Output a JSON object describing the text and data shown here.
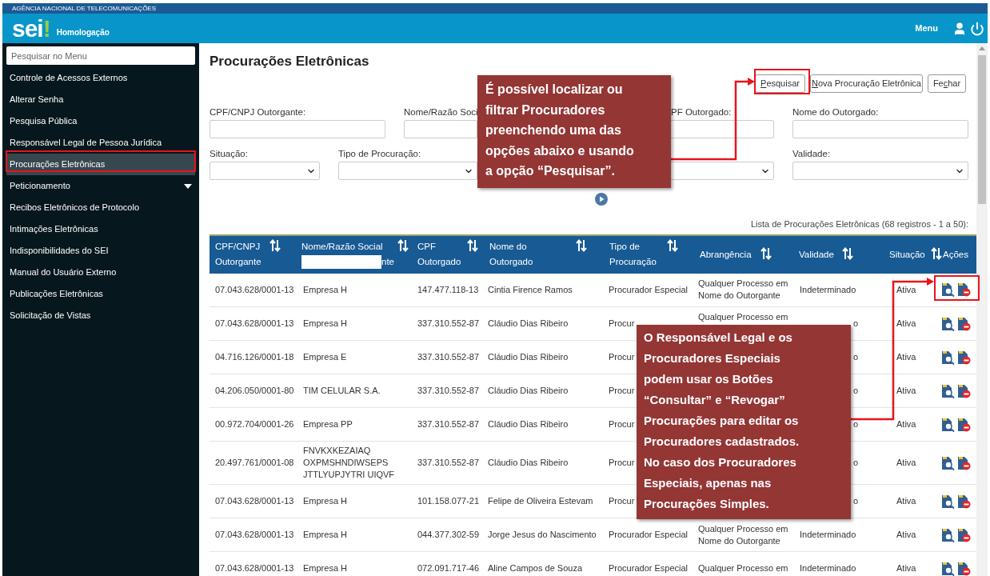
{
  "agency": "AGÊNCIA NACIONAL DE TELECOMUNICAÇÕES",
  "header": {
    "logo": "sei",
    "logo_mark": "!",
    "environment": "Homologação",
    "menu": "Menu"
  },
  "sidebar": {
    "search": {
      "placeholder": "Pesquisar no Menu"
    },
    "items": [
      {
        "label": "Controle de Acessos Externos",
        "selected": false,
        "expandable": false
      },
      {
        "label": "Alterar Senha",
        "selected": false,
        "expandable": false
      },
      {
        "label": "Pesquisa Pública",
        "selected": false,
        "expandable": false
      },
      {
        "label": "Responsável Legal de Pessoa Jurídica",
        "selected": false,
        "expandable": false
      },
      {
        "label": "Procurações Eletrônicas",
        "selected": true,
        "expandable": false
      },
      {
        "label": "Peticionamento",
        "selected": false,
        "expandable": true
      },
      {
        "label": "Recibos Eletrônicos de Protocolo",
        "selected": false,
        "expandable": false
      },
      {
        "label": "Intimações Eletrônicas",
        "selected": false,
        "expandable": false
      },
      {
        "label": "Indisponibilidades do SEI",
        "selected": false,
        "expandable": false
      },
      {
        "label": "Manual do Usuário Externo",
        "selected": false,
        "expandable": false
      },
      {
        "label": "Publicações Eletrônicas",
        "selected": false,
        "expandable": false
      },
      {
        "label": "Solicitação de Vistas",
        "selected": false,
        "expandable": false
      }
    ]
  },
  "page": {
    "title": "Procurações Eletrônicas",
    "buttons": [
      {
        "key": "P",
        "post": "esquisar"
      },
      {
        "key": "N",
        "post": "ova Procuração Eletrônica"
      },
      {
        "pre": "Fe",
        "key": "c",
        "post": "har"
      }
    ],
    "filters_row_1": [
      {
        "label": "CPF/CNPJ Outorgante:",
        "kind": "input"
      },
      {
        "label": "Nome/Razão Soci",
        "kind": "input"
      },
      {
        "label": "PF Outorgado:",
        "kind": "input"
      },
      {
        "label": "Nome do Outorgado:",
        "kind": "input"
      }
    ],
    "filters_row_2": [
      {
        "label": "Situação:",
        "kind": "select"
      },
      {
        "label": "Tipo de Procuração:",
        "kind": "select"
      },
      {
        "kind": "select"
      },
      {
        "label": "Validade:",
        "kind": "select"
      }
    ],
    "caption": "Lista de Procurações Eletrônicas (68 registros - 1 a 50):"
  },
  "table": {
    "columns": [
      {
        "label": "CPF/CNPJ Outorgante",
        "sortable": true
      },
      {
        "label": "Nome/Razão Social",
        "second_line": "nte",
        "redacted": true,
        "sortable": true
      },
      {
        "label": "CPF Outorgado",
        "sortable": true
      },
      {
        "label": "Nome do Outorgado",
        "sortable": true
      },
      {
        "label": "Tipo de Procuração",
        "sortable": true
      },
      {
        "label": "Abrangência",
        "sortable": true
      },
      {
        "label": "Validade",
        "sortable": true
      },
      {
        "label": "Situação",
        "sortable": true
      },
      {
        "label": "Ações",
        "sortable": false
      }
    ],
    "rows": [
      {
        "kind": "full",
        "cnpj": "07.043.628/0001-13",
        "razao": "Empresa H",
        "cpf": "147.477.118-13",
        "nome": "Cintia Firence Ramos",
        "tipo": "Procurador Especial",
        "abrangencia": "Qualquer Processo em Nome do Outorgante",
        "validade": "Indeterminado",
        "situacao": "Ativa"
      },
      {
        "kind": "covered",
        "cnpj": "07.043.628/0001-13",
        "razao": "Empresa H",
        "cpf": "337.310.552-87",
        "nome": "Cláudio Dias Ribeiro",
        "tipo": "Procur",
        "abrangencia": "Qualquer Processo em",
        "validade": "o",
        "situacao": "Ativa"
      },
      {
        "kind": "covered",
        "cnpj": "04.716.126/0001-18",
        "razao": "Empresa E",
        "cpf": "337.310.552-87",
        "nome": "Cláudio Dias Ribeiro",
        "tipo": "Procur",
        "validade": "o",
        "situacao": "Ativa"
      },
      {
        "kind": "covered",
        "cnpj": "04.206.050/0001-80",
        "razao": "TIM CELULAR S.A.",
        "cpf": "337.310.552-87",
        "nome": "Cláudio Dias Ribeiro",
        "tipo": "Procur",
        "validade": "o",
        "situacao": "Ativa"
      },
      {
        "kind": "covered",
        "cnpj": "00.972.704/0001-26",
        "razao": "Empresa PP",
        "cpf": "337.310.552-87",
        "nome": "Cláudio Dias Ribeiro",
        "tipo": "Procur",
        "validade": "o",
        "situacao": "Ativa"
      },
      {
        "kind": "covered",
        "cnpj": "20.497.761/0001-08",
        "razao": "FNVKXKEZAIAQ OXPMSHNDIWSEPS JTTLYUPJYTRI UIQVF",
        "cpf": "337.310.552-87",
        "nome": "Cláudio Dias Ribeiro",
        "tipo": "Procur",
        "validade": "o",
        "situacao": "Ativa"
      },
      {
        "kind": "covered",
        "cnpj": "07.043.628/0001-13",
        "razao": "Empresa H",
        "cpf": "101.158.077-21",
        "nome": "Felipe de Oliveira Estevam",
        "tipo": "Procur",
        "validade": "o",
        "situacao": "Ativa"
      },
      {
        "kind": "full",
        "cnpj": "07.043.628/0001-13",
        "razao": "Empresa H",
        "cpf": "044.377.302-59",
        "nome": "Jorge Jesus do Nascimento",
        "tipo": "Procurador Especial",
        "abrangencia": "Qualquer Processo em Nome do Outorgante",
        "validade": "Indeterminado",
        "situacao": "Ativa"
      },
      {
        "kind": "full",
        "cnpj": "07.043.628/0001-13",
        "razao": "Empresa H",
        "cpf": "072.091.717-46",
        "nome": "Aline Campos de Souza",
        "tipo": "Procurador Especial",
        "abrangencia": "Qualquer Processo em",
        "validade": "Indeterminado",
        "situacao": "Ativa"
      }
    ]
  },
  "callouts": [
    {
      "text": "É possível localizar ou\nfiltrar Procuradores\npreenchendo uma das\nopções abaixo e usando\na opção “Pesquisar”."
    },
    {
      "text": "O Responsável Legal e os\nProcuradores Especiais\npodem usar os Botões\n“Consultar” e “Revogar”\nProcurações para editar os\nProcuradores cadastrados.\nNo caso dos Procuradores\nEspeciais, apenas nas\nProcurações Simples."
    }
  ]
}
